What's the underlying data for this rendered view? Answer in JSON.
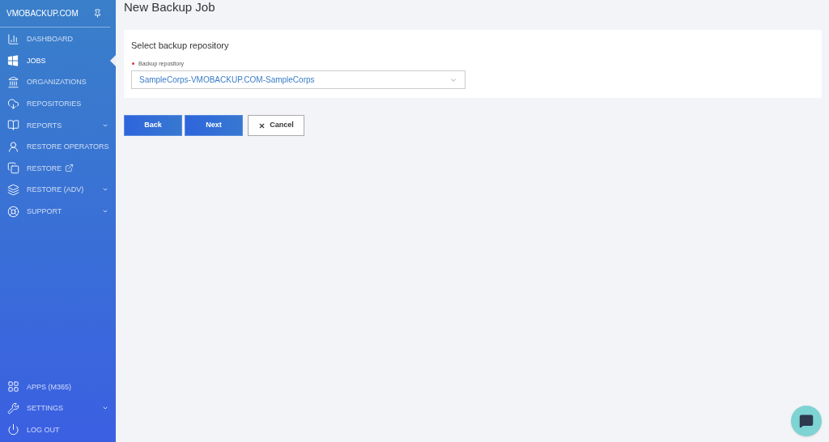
{
  "sidebar": {
    "brand": "VMOBACKUP.COM",
    "items": [
      {
        "label": "DASHBOARD",
        "selected": false,
        "has_submenu": false,
        "external": false
      },
      {
        "label": "JOBS",
        "selected": true,
        "has_submenu": false,
        "external": false
      },
      {
        "label": "ORGANIZATIONS",
        "selected": false,
        "has_submenu": false,
        "external": false
      },
      {
        "label": "REPOSITORIES",
        "selected": false,
        "has_submenu": false,
        "external": false
      },
      {
        "label": "REPORTS",
        "selected": false,
        "has_submenu": true,
        "external": false
      },
      {
        "label": "RESTORE OPERATORS",
        "selected": false,
        "has_submenu": false,
        "external": false
      },
      {
        "label": "RESTORE",
        "selected": false,
        "has_submenu": false,
        "external": true
      },
      {
        "label": "RESTORE (ADV)",
        "selected": false,
        "has_submenu": true,
        "external": false
      },
      {
        "label": "SUPPORT",
        "selected": false,
        "has_submenu": true,
        "external": false
      }
    ],
    "bottom_items": [
      {
        "label": "APPS (M365)",
        "selected": false,
        "has_submenu": false
      },
      {
        "label": "SETTINGS",
        "selected": false,
        "has_submenu": true
      },
      {
        "label": "LOG OUT",
        "selected": false,
        "has_submenu": false
      }
    ]
  },
  "page_title": "New Backup Job",
  "card": {
    "title": "Select backup repository",
    "field": {
      "label": "Backup repository",
      "required": true,
      "value": "SampleCorps-VMOBACKUP.COM-SampleCorps"
    }
  },
  "buttons": [
    {
      "label": "Back",
      "kind": "primary"
    },
    {
      "label": "Next",
      "kind": "primary"
    },
    {
      "label": "Cancel",
      "kind": "cancel"
    }
  ]
}
